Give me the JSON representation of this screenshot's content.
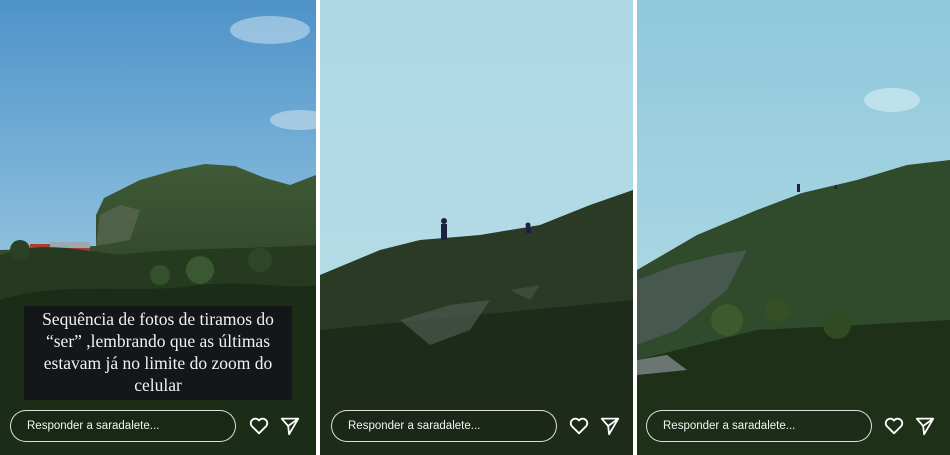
{
  "stories": [
    {
      "caption": "Sequência de fotos de tiramos do “ser” ,lembrando que as últimas estavam já no limite do zoom do celular",
      "reply_placeholder": "Responder a saradalete..."
    },
    {
      "reply_placeholder": "Responder a saradalete..."
    },
    {
      "reply_placeholder": "Responder a saradalete..."
    }
  ],
  "icons": {
    "like": "heart-icon",
    "share": "send-icon"
  },
  "colors": {
    "text": "#ffffff",
    "caption_bg": "#14171a"
  }
}
